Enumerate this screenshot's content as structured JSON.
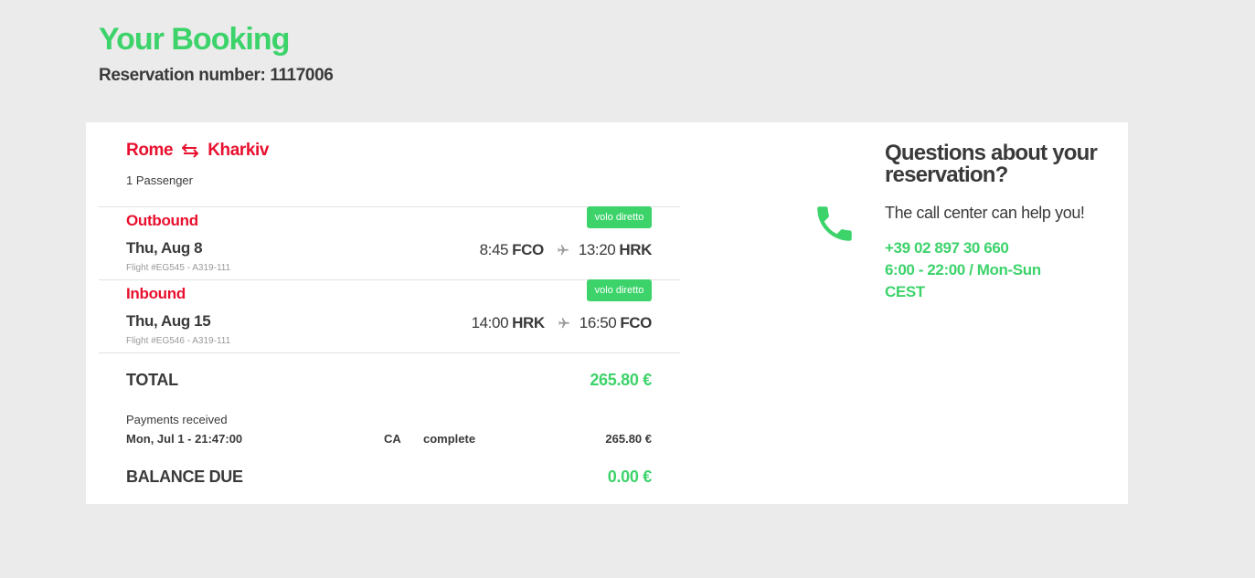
{
  "header": {
    "title": "Your Booking",
    "reservation_label": "Reservation number: 1117006"
  },
  "route": {
    "from": "Rome",
    "to": "Kharkiv",
    "swap_icon": "swap-arrows-icon",
    "passengers": "1 Passenger"
  },
  "legs": [
    {
      "label": "Outbound",
      "badge": "volo diretto",
      "date": "Thu, Aug 8",
      "flight": "Flight #EG545 - A319-111",
      "depart_time": "8:45",
      "depart_code": "FCO",
      "arrive_time": "13:20",
      "arrive_code": "HRK"
    },
    {
      "label": "Inbound",
      "badge": "volo diretto",
      "date": "Thu, Aug 15",
      "flight": "Flight #EG546 - A319-111",
      "depart_time": "14:00",
      "depart_code": "HRK",
      "arrive_time": "16:50",
      "arrive_code": "FCO"
    }
  ],
  "summary": {
    "total_label": "TOTAL",
    "total_value": "265.80 €",
    "payments_label": "Payments received",
    "payment": {
      "date": "Mon, Jul 1 - 21:47:00",
      "method": "CA",
      "status": "complete",
      "amount": "265.80 €"
    },
    "balance_label": "BALANCE DUE",
    "balance_value": "0.00 €"
  },
  "help": {
    "title": "Questions about your reservation?",
    "text": "The call center can help you!",
    "phone": "+39 02 897 30 660",
    "hours": "6:00 - 22:00 / Mon-Sun",
    "timezone": "CEST",
    "icon": "phone-icon"
  },
  "colors": {
    "accent_green": "#3dd36b",
    "accent_red": "#e8102e",
    "text_dark": "#3a3a3a",
    "background": "#ebebeb"
  }
}
